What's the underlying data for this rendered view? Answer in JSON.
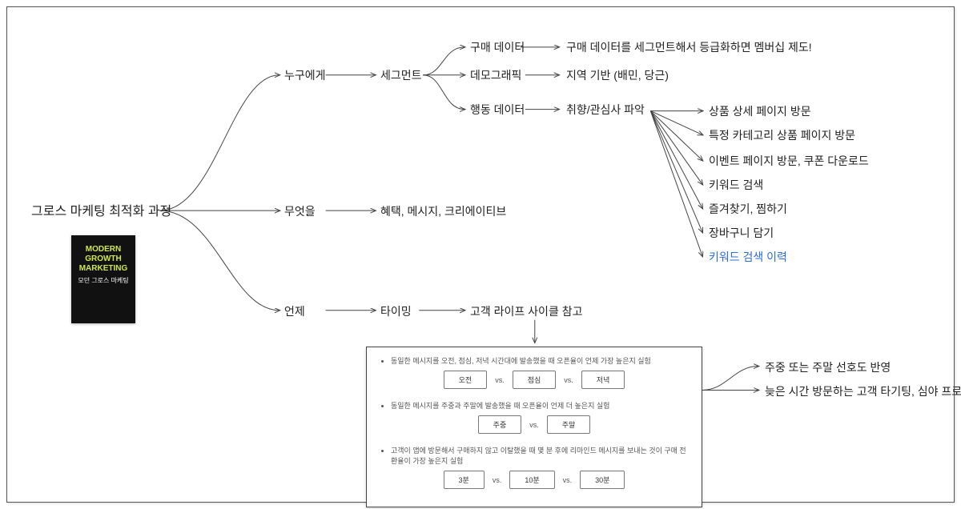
{
  "root": "그로스 마케팅 최적화 과정",
  "book": {
    "title_line1": "MODERN",
    "title_line2": "GROWTH",
    "title_line3": "MARKETING",
    "subtitle": "모던 그로스 마케팅",
    "tiny": ""
  },
  "branches": {
    "who": {
      "label": "누구에게",
      "child": "세그먼트",
      "segments": {
        "purchase": {
          "label": "구매 데이터",
          "note": "구매 데이터를 세그먼트해서 등급화하면 멤버십 제도!"
        },
        "demo": {
          "label": "데모그래픽",
          "note": "지역 기반 (배민, 당근)"
        },
        "behavior": {
          "label": "행동 데이터",
          "note": "취향/관심사 파악",
          "examples": [
            "상품 상세 페이지 방문",
            "특정 카테고리 상품 페이지 방문",
            "이벤트 페이지 방문, 쿠폰 다운로드",
            "키워드 검색",
            "즐겨찾기, 찜하기",
            "장바구니 담기",
            "키워드 검색 이력"
          ]
        }
      }
    },
    "what": {
      "label": "무엇을",
      "child": "혜택, 메시지, 크리에이티브"
    },
    "when": {
      "label": "언제",
      "child": "타이밍",
      "note": "고객 라이프 사이클 참고"
    }
  },
  "panel": {
    "exp1": {
      "desc": "동일한 메시지를 오전, 점심, 저녁 시간대에 발송했을 때 오픈율이 언제 가장 높은지 실험",
      "opts": [
        "오전",
        "점심",
        "저녁"
      ]
    },
    "exp2": {
      "desc": "동일한 메시지를 주중과 주말에 발송했을 때 오픈율이 언제 더 높은지 실험",
      "opts": [
        "주중",
        "주말"
      ]
    },
    "exp3": {
      "desc": "고객이 앱에 방문해서 구매하지 않고 이탈했을 때 몇 분 후에 리마인드 메시지를 보내는 것이 구매 전환율이 가장 높은지 실험",
      "opts": [
        "3분",
        "10분",
        "30분"
      ]
    },
    "vs": "vs."
  },
  "side_notes": [
    "주중 또는 주말 선호도 반영",
    "늦은 시간 방문하는 고객 타기팅, 심야 프로모션 등"
  ]
}
